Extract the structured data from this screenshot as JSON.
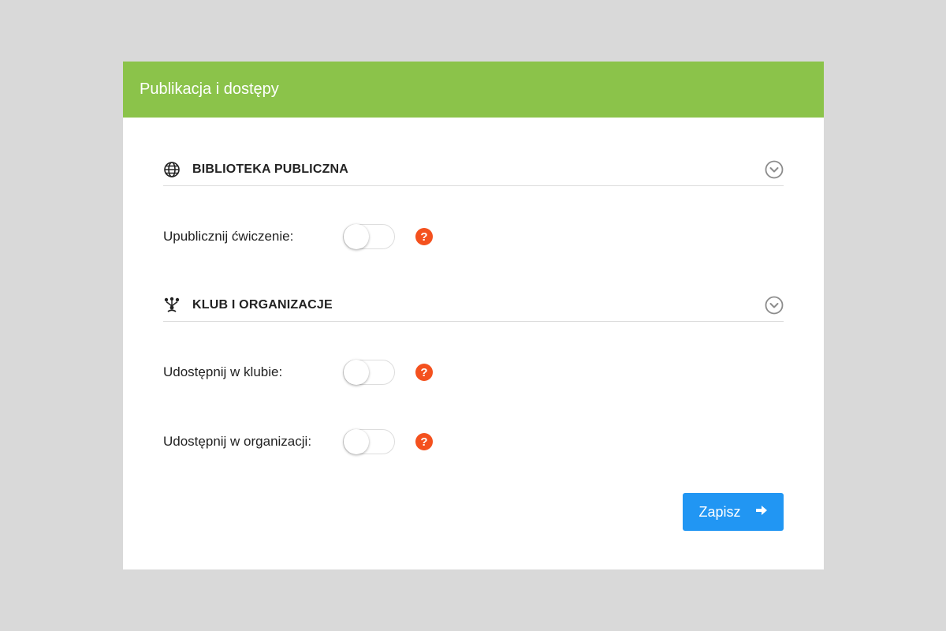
{
  "header": {
    "title": "Publikacja i dostępy"
  },
  "sections": [
    {
      "icon": "globe-icon",
      "title": "BIBLIOTEKA PUBLICZNA",
      "rows": [
        {
          "label": "Upublicznij ćwiczenie:",
          "enabled": false,
          "help": "?"
        }
      ]
    },
    {
      "icon": "network-icon",
      "title": "KLUB I ORGANIZACJE",
      "rows": [
        {
          "label": "Udostępnij w klubie:",
          "enabled": false,
          "help": "?"
        },
        {
          "label": "Udostępnij w organizacji:",
          "enabled": false,
          "help": "?"
        }
      ]
    }
  ],
  "save_button": {
    "label": "Zapisz",
    "icon": "arrow-right-icon"
  },
  "colors": {
    "header": "#8bc34a",
    "help": "#f4511e",
    "primary_button": "#2196f3",
    "background": "#d9d9d9"
  }
}
